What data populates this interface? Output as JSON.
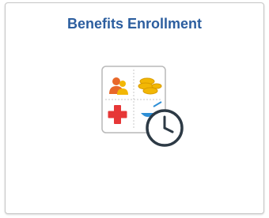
{
  "tile": {
    "title": "Benefits Enrollment",
    "icon": "benefits-enrollment-icon",
    "title_color": "#2c5e9f"
  },
  "icon_parts": [
    "people-icon",
    "coins-icon",
    "medical-cross-icon",
    "dental-icon",
    "clock-icon"
  ],
  "colors": {
    "title": "#2c5e9f",
    "orange": "#e8682a",
    "gold": "#f2b705",
    "red": "#e63737",
    "blue": "#2e8fd6",
    "clock": "#2d3a45"
  }
}
